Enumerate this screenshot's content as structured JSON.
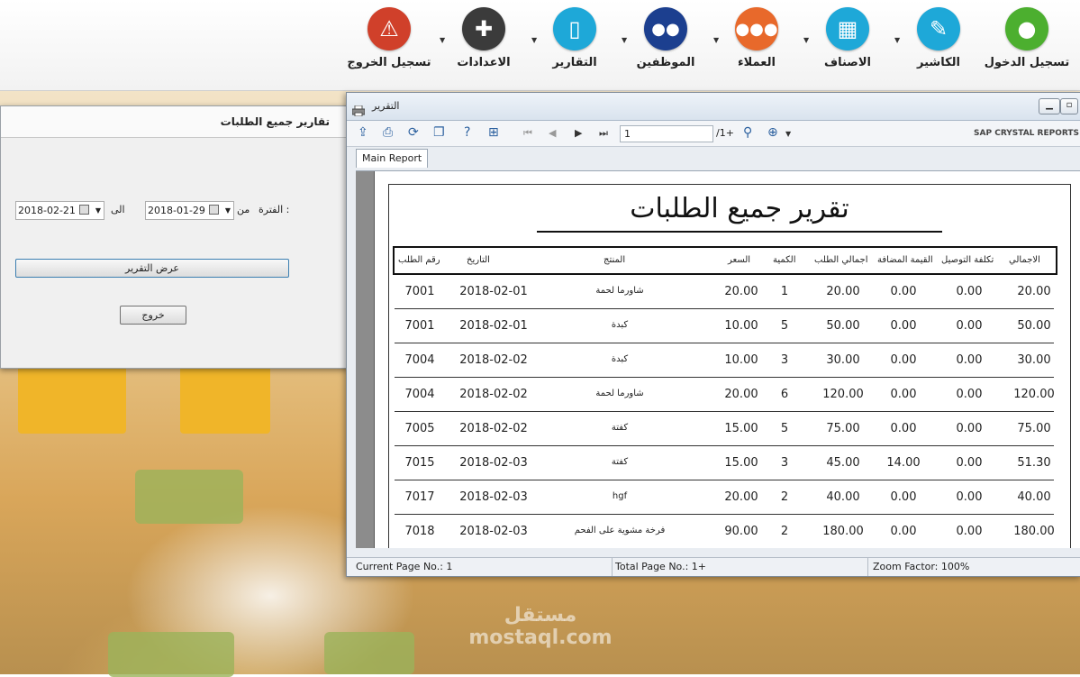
{
  "toolbar": {
    "items": [
      {
        "label": "تسجيل الدخول",
        "icon": "lock-icon",
        "color": "#4caf2f",
        "glyph": "🔒"
      },
      {
        "label": "الكاشير",
        "icon": "notepad-pen-icon",
        "color": "#1ea8d8",
        "glyph": "✎"
      },
      {
        "label": "الاصناف",
        "icon": "grid-icon",
        "color": "#1ea8d8",
        "glyph": "▦"
      },
      {
        "label": "العملاء",
        "icon": "users-group-icon",
        "color": "#e8692b",
        "glyph": "👥"
      },
      {
        "label": "الموظفين",
        "icon": "employees-icon",
        "color": "#1c3f8f",
        "glyph": "👤"
      },
      {
        "label": "التقارير",
        "icon": "document-icon",
        "color": "#1ea8d8",
        "glyph": "▯"
      },
      {
        "label": "الاعدادات",
        "icon": "wrench-icon",
        "color": "#3b3b3b",
        "glyph": "🔧"
      },
      {
        "label": "تسجيل الخروج",
        "icon": "warning-icon",
        "color": "#d0402a",
        "glyph": "⚠"
      }
    ]
  },
  "dialog": {
    "title": "تقارير جميع الطلبات",
    "period_label": "الفترة :",
    "from_label": "من",
    "to_label": "الى",
    "from_date": "2018-01-29",
    "to_date": "2018-02-21",
    "show_report_label": "عرض التقرير",
    "exit_label": "خروج"
  },
  "report_window": {
    "title": "التقرير",
    "page_value": "1",
    "page_total": "/1+",
    "brand": "SAP CRYSTAL REPORTS",
    "tab_label": "Main Report",
    "report_title": "تقرير جميع الطلبات",
    "columns": {
      "total": "الاجمالي",
      "delivery": "تكلفة التوصيل",
      "vat": "القيمة المضافة",
      "order_total": "اجمالي الطلب",
      "qty": "الكمية",
      "price": "السعر",
      "product": "المنتج",
      "date": "التاريخ",
      "order_no": "رقم الطلب"
    },
    "rows": [
      {
        "total": "20.00",
        "delivery": "0.00",
        "vat": "0.00",
        "order_total": "20.00",
        "qty": "1",
        "price": "20.00",
        "product": "شاورما لحمة",
        "date": "2018-02-01",
        "order_no": "7001"
      },
      {
        "total": "50.00",
        "delivery": "0.00",
        "vat": "0.00",
        "order_total": "50.00",
        "qty": "5",
        "price": "10.00",
        "product": "كبدة",
        "date": "2018-02-01",
        "order_no": "7001"
      },
      {
        "total": "30.00",
        "delivery": "0.00",
        "vat": "0.00",
        "order_total": "30.00",
        "qty": "3",
        "price": "10.00",
        "product": "كبدة",
        "date": "2018-02-02",
        "order_no": "7004"
      },
      {
        "total": "120.00",
        "delivery": "0.00",
        "vat": "0.00",
        "order_total": "120.00",
        "qty": "6",
        "price": "20.00",
        "product": "شاورما لحمة",
        "date": "2018-02-02",
        "order_no": "7004"
      },
      {
        "total": "75.00",
        "delivery": "0.00",
        "vat": "0.00",
        "order_total": "75.00",
        "qty": "5",
        "price": "15.00",
        "product": "كفتة",
        "date": "2018-02-02",
        "order_no": "7005"
      },
      {
        "total": "51.30",
        "delivery": "0.00",
        "vat": "14.00",
        "order_total": "45.00",
        "qty": "3",
        "price": "15.00",
        "product": "كفتة",
        "date": "2018-02-03",
        "order_no": "7015"
      },
      {
        "total": "40.00",
        "delivery": "0.00",
        "vat": "0.00",
        "order_total": "40.00",
        "qty": "2",
        "price": "20.00",
        "product": "hgf",
        "date": "2018-02-03",
        "order_no": "7017"
      },
      {
        "total": "180.00",
        "delivery": "0.00",
        "vat": "0.00",
        "order_total": "180.00",
        "qty": "2",
        "price": "90.00",
        "product": "فرخة مشوية على الفحم",
        "date": "2018-02-03",
        "order_no": "7018"
      }
    ],
    "status": {
      "current_page": "Current Page No.: 1",
      "total_page": "Total Page No.: 1+",
      "zoom": "Zoom Factor: 100%"
    }
  },
  "watermark": "مستقل mostaql.com"
}
